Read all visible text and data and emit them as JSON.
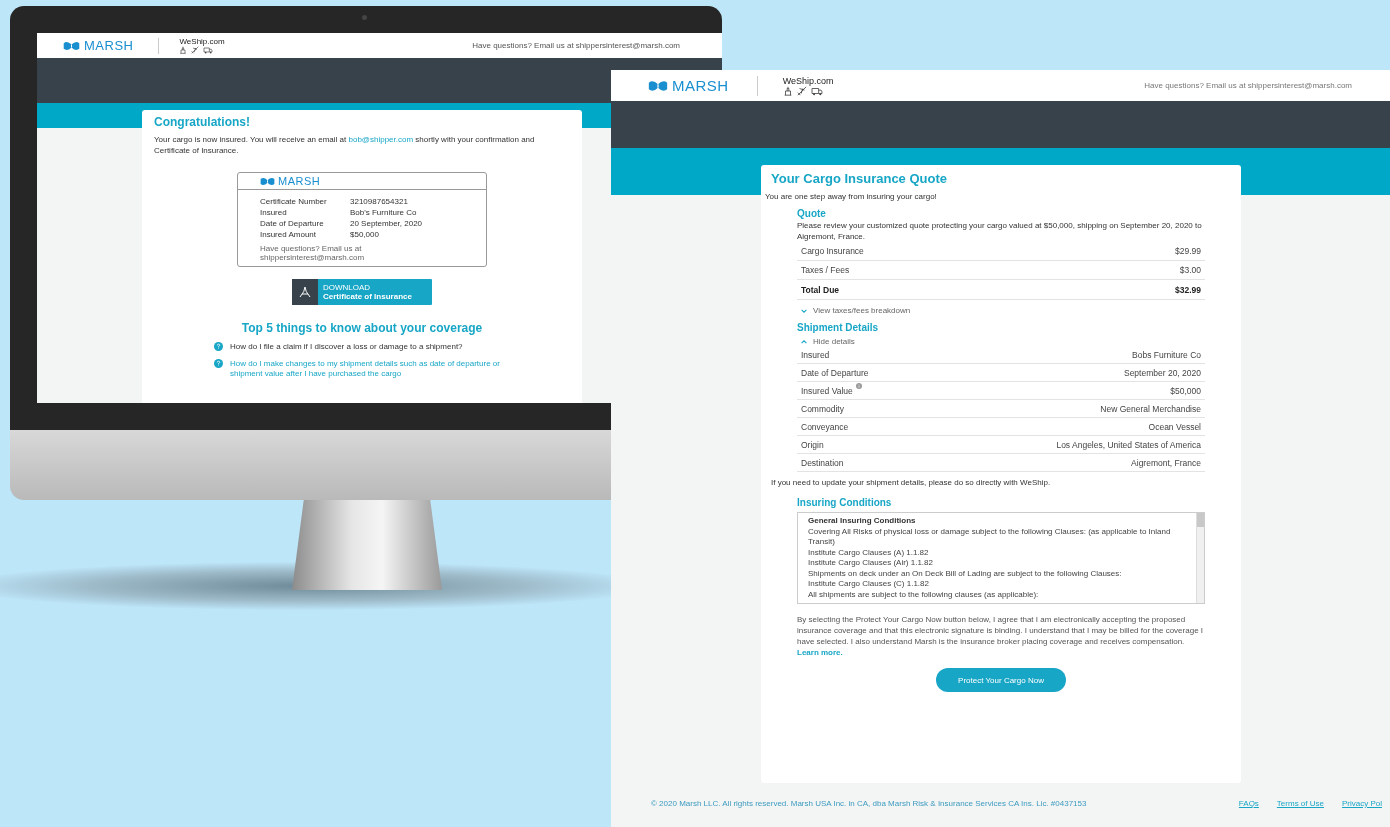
{
  "back_screen": {
    "header": {
      "logo": "MARSH",
      "partner": "WeShip.com",
      "contact": "Have questions?  Email us at shippersinterest@marsh.com"
    },
    "card": {
      "title": "Congratulations!",
      "message_before": "Your cargo is now insured. You will receive an email at ",
      "message_link": "bob@shipper.com",
      "message_after": " shortly with your confirmation and Certificate of Insurance."
    },
    "certificate": {
      "logo": "MARSH",
      "rows": [
        {
          "label": "Certificate Number",
          "value": "3210987654321"
        },
        {
          "label": "Insured",
          "value": "Bob's Furniture Co"
        },
        {
          "label": "Date of Departure",
          "value": "20 September, 2020"
        },
        {
          "label": "Insured Amount",
          "value": "$50,000"
        }
      ],
      "footnote": "Have questions? Email us at shippersinterest@marsh.com"
    },
    "download_button": {
      "caption": "DOWNLOAD",
      "label": "Certificate of Insurance"
    },
    "faq": {
      "title": "Top 5 things to know about your coverage",
      "items": [
        {
          "question": "How do I file a claim if I discover a loss or damage to a shipment?",
          "highlighted": false
        },
        {
          "question": "How do I make changes to my shipment details such as date of departure or shipment value after I have purchased the cargo",
          "highlighted": true
        }
      ]
    }
  },
  "front_page": {
    "header": {
      "logo": "MARSH",
      "partner": "WeShip.com",
      "contact": "Have questions?  Email us at shippersinterest@marsh.com"
    },
    "title": "Your Cargo Insurance Quote",
    "intro": "You are one step away from insuring your cargo!",
    "quote": {
      "title": "Quote",
      "description": "Please review your customized quote protecting your cargo valued at $50,000, shipping on September 20, 2020 to Aigremont, France.",
      "rows": [
        {
          "label": "Cargo Insurance",
          "value": "$29.99",
          "kind": "line"
        },
        {
          "label": "Taxes / Fees",
          "value": "$3.00",
          "kind": "line"
        },
        {
          "label": "Total Due",
          "value": "$32.99",
          "kind": "total"
        }
      ],
      "toggle": {
        "label": "View taxes/fees breakdown",
        "expanded": false
      }
    },
    "shipment": {
      "title": "Shipment Details",
      "toggle": {
        "label": "Hide details",
        "expanded": true
      },
      "rows": [
        {
          "label": "Insured",
          "value": "Bobs Furniture Co",
          "info": false
        },
        {
          "label": "Date of Departure",
          "value": "September 20, 2020",
          "info": false
        },
        {
          "label": "Insured Value",
          "value": "$50,000",
          "info": true
        },
        {
          "label": "Commodity",
          "value": "New General Merchandise",
          "info": false
        },
        {
          "label": "Conveyance",
          "value": "Ocean Vessel",
          "info": false
        },
        {
          "label": "Origin",
          "value": "Los Angeles, United  States of America",
          "info": false
        },
        {
          "label": "Destination",
          "value": "Aigremont, France",
          "info": false
        }
      ],
      "note": "If you need to update your shipment details, please do so directly with WeShip."
    },
    "conditions": {
      "title": "Insuring Conditions",
      "lines": [
        {
          "text": "General Insuring Conditions",
          "kind": "heading"
        },
        {
          "text": "Covering All Risks of physical loss or damage subject to the following Clauses: (as applicable to Inland Transit)",
          "kind": "line"
        },
        {
          "text": "Institute Cargo Clauses (A) 1.1.82",
          "kind": "line"
        },
        {
          "text": "Institute Cargo Clauses (Air) 1.1.82",
          "kind": "line"
        },
        {
          "text": "Shipments on deck under an On Deck Bill of Lading are subject to the following Clauses:",
          "kind": "line"
        },
        {
          "text": "Institute Cargo Clauses (C) 1.1.82",
          "kind": "line"
        },
        {
          "text": "All shipments are subject to the following clauses (as applicable):",
          "kind": "line"
        }
      ]
    },
    "consent": {
      "text": "By selecting the Protect Your Cargo Now button below, I agree that I am electronically accepting the proposed insurance coverage and that this electronic signature is binding. I understand that I may be billed for the coverage I have selected. I also understand Marsh is the insurance broker placing coverage and receives compensation. ",
      "link": "Learn more."
    },
    "button": "Protect Your Cargo Now",
    "footer": {
      "copyright": "© 2020 Marsh LLC. All rights reserved. Marsh USA Inc. in CA, dba Marsh Risk & Insurance Services CA Ins. Lic. #0437153",
      "links": [
        "FAQs",
        "Terms of Use",
        "Privacy Pol"
      ]
    }
  }
}
